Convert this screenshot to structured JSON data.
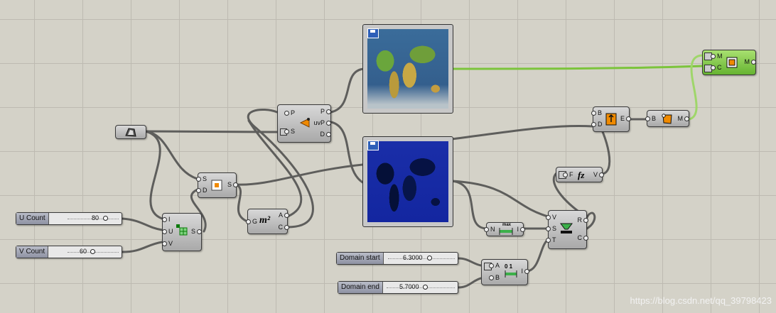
{
  "sliders": {
    "u_count": {
      "label": "U Count",
      "value": "80"
    },
    "v_count": {
      "label": "V Count",
      "value": "60"
    },
    "domain_start": {
      "label": "Domain start",
      "value": "6.3000"
    },
    "domain_end": {
      "label": "Domain end",
      "value": "5.7000"
    }
  },
  "components": {
    "divide_surface": {
      "inputs": [
        "I",
        "U",
        "V"
      ],
      "outputs": [
        "S"
      ]
    },
    "surface": {
      "inputs": [
        "S",
        "D"
      ],
      "outputs": [
        "S"
      ]
    },
    "evaluate": {
      "inputs": [
        "P",
        "S"
      ],
      "outputs": [
        "P",
        "uvP",
        "D"
      ]
    },
    "area": {
      "inputs": [
        "G"
      ],
      "outputs": [
        "A",
        "C"
      ],
      "symbol": "m²"
    },
    "bounds": {
      "inputs": [
        "N"
      ],
      "outputs": [
        "I"
      ],
      "caption": "max"
    },
    "remap": {
      "inputs": [
        "V",
        "S",
        "T"
      ],
      "outputs": [
        "R",
        "C"
      ]
    },
    "construct_domain": {
      "inputs": [
        "A",
        "B"
      ],
      "outputs": [
        "I"
      ],
      "caption": "0 1"
    },
    "expression": {
      "inputs": [
        "F"
      ],
      "outputs": [
        "V"
      ],
      "symbol": "fz"
    },
    "list_item": {
      "inputs": [
        "B",
        "D"
      ],
      "outputs": [
        "E"
      ]
    },
    "shader": {
      "inputs": [
        "B"
      ],
      "outputs": [
        "M"
      ]
    },
    "mesh_colour": {
      "inputs": [
        "M",
        "C"
      ],
      "outputs": [
        "M"
      ]
    }
  },
  "watermark": "https://blog.csdn.net/qq_39798423",
  "colors": {
    "canvas": "#d4d2c8",
    "grid": "#bdbab1",
    "wire": "#555555",
    "wire_selected": "#7cc43c",
    "map_blue": "#1326a0"
  }
}
